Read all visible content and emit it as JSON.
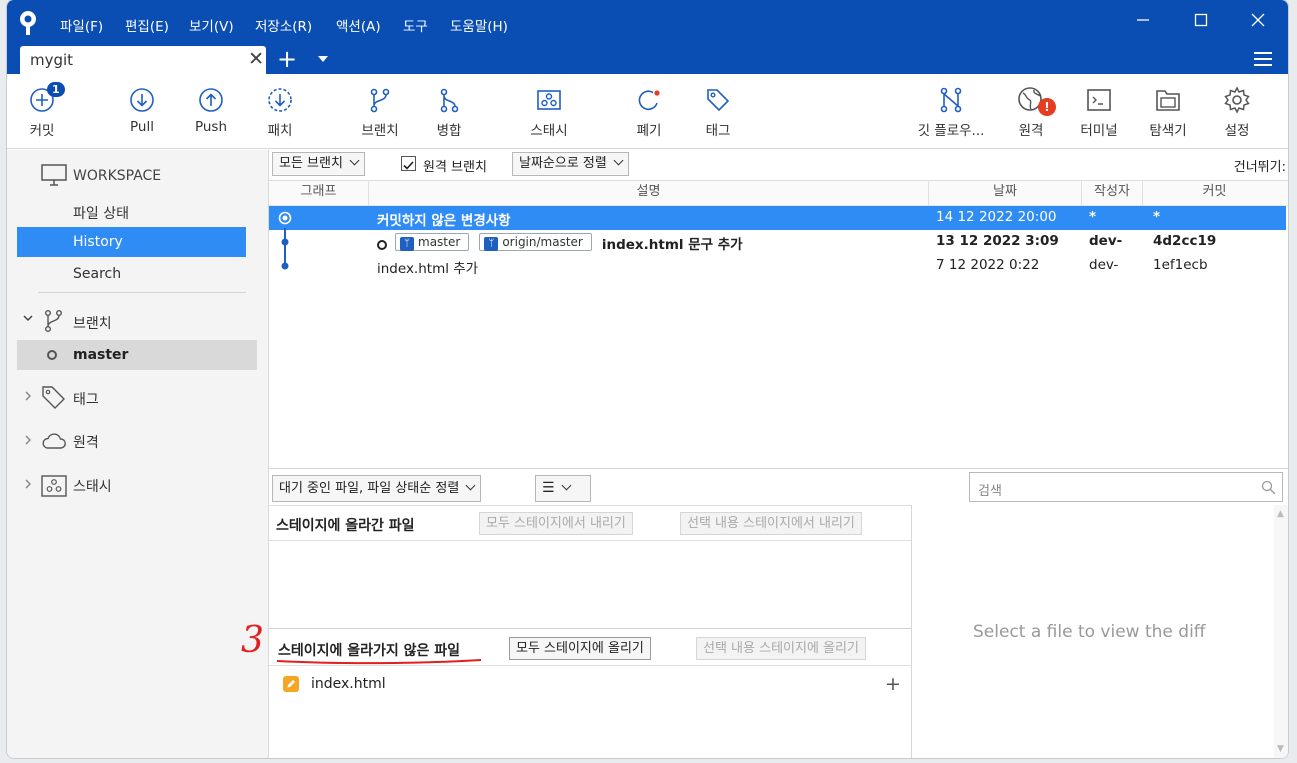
{
  "menu": [
    "파일(F)",
    "편집(E)",
    "보기(V)",
    "저장소(R)",
    "액션(A)",
    "도구",
    "도움말(H)"
  ],
  "tab": {
    "label": "mygit"
  },
  "toolbar": {
    "commit": "커밋",
    "commit_badge": "1",
    "pull": "Pull",
    "push": "Push",
    "patch": "패치",
    "branch": "브랜치",
    "merge": "병합",
    "stash": "스태시",
    "discard": "폐기",
    "tag": "태그",
    "gitflow": "깃 플로우...",
    "remote": "원격",
    "terminal": "터미널",
    "explorer": "탐색기",
    "settings": "설정"
  },
  "sidebar": {
    "workspace": "WORKSPACE",
    "file_status": "파일 상태",
    "history": "History",
    "search": "Search",
    "branches": "브랜치",
    "master": "master",
    "tags": "태그",
    "remotes": "원격",
    "stashes": "스태시"
  },
  "filters": {
    "all_branches": "모든 브랜치",
    "remote_branches": "원격 브랜치",
    "sort": "날짜순으로 정렬",
    "jump": "건너뛰기:"
  },
  "columns": {
    "graph": "그래프",
    "desc": "설명",
    "date": "날짜",
    "author": "작성자",
    "commit": "커밋"
  },
  "commits": [
    {
      "desc": "커밋하지 않은 변경사항",
      "date": "14 12 2022 20:00",
      "author": "*",
      "hash": "*"
    },
    {
      "ref1": "master",
      "ref2": "origin/master",
      "desc": "index.html 문구 추가",
      "date": "13 12 2022 3:09",
      "author": "dev-",
      "hash": "4d2cc19"
    },
    {
      "desc": "index.html 추가",
      "date": "7 12 2022 0:22",
      "author": "dev-",
      "hash": "1ef1ecb"
    }
  ],
  "lower": {
    "sort_pending": "대기 중인 파일, 파일 상태순 정렬",
    "search_placeholder": "검색",
    "staged_title": "스테이지에 올라간 파일",
    "unstage_all": "모두 스테이지에서 내리기",
    "unstage_selected": "선택 내용 스테이지에서 내리기",
    "unstaged_title": "스테이지에 올라가지 않은 파일",
    "stage_all": "모두 스테이지에 올리기",
    "stage_selected": "선택 내용 스테이지에 올리기",
    "file": "index.html",
    "diff_placeholder": "Select a file to view the diff",
    "annotation": "3"
  },
  "colors": {
    "accent": "#0a4db3",
    "selected_row": "#2f8cf4",
    "annotation": "#e01f1f"
  }
}
